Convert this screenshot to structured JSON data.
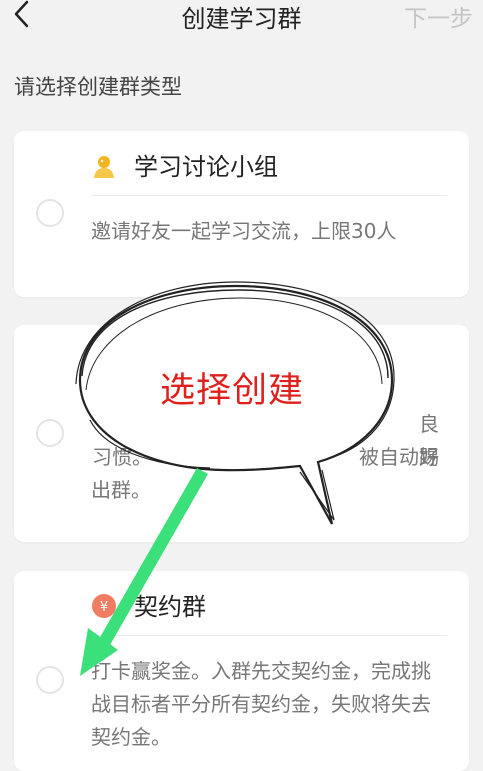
{
  "header": {
    "title": "创建学习群",
    "next_label": "下一步",
    "back_icon": "chevron-left-icon"
  },
  "section_label": "请选择创建群类型",
  "cards": [
    {
      "name": "学习讨论小组",
      "icon": "person-icon",
      "description": "邀请好友一起学习交流，上限30人"
    },
    {
      "name": "",
      "icon": "",
      "description_line2_right": "良好",
      "description_line2_left": "习惯。",
      "description_line3_right": "被自动踢",
      "description_line4": "出群。"
    },
    {
      "name": "契约群",
      "icon": "yuan-coin-icon",
      "description": "打卡赢奖金。入群先交契约金，完成挑战目标者平分所有契约金，失败将失去契约金。"
    }
  ],
  "annotation": {
    "text": "选择创建",
    "text_color": "#e0201c",
    "arrow_color": "#3be07a"
  },
  "colors": {
    "background": "#f2f2f2",
    "card": "#ffffff",
    "next_disabled": "#c4c4c4"
  }
}
